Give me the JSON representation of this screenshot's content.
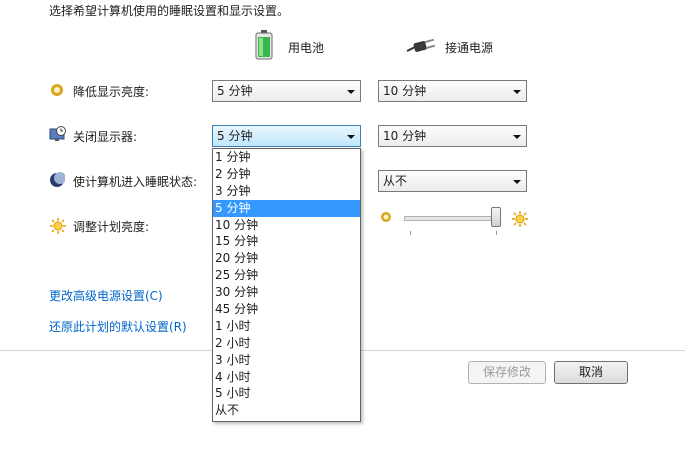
{
  "intro": "选择希望计算机使用的睡眠设置和显示设置。",
  "columns": {
    "battery": "用电池",
    "plugged": "接通电源"
  },
  "rows": {
    "dim": {
      "label": "降低显示亮度:",
      "battery_value": "5 分钟",
      "plugged_value": "10 分钟"
    },
    "display_off": {
      "label": "关闭显示器:",
      "battery_value": "5 分钟",
      "plugged_value": "10 分钟"
    },
    "sleep": {
      "label": "使计算机进入睡眠状态:",
      "plugged_value": "从不"
    },
    "brightness": {
      "label": "调整计划亮度:",
      "level_fraction": 1.0
    }
  },
  "dropdown": {
    "options": [
      "1 分钟",
      "2 分钟",
      "3 分钟",
      "5 分钟",
      "10 分钟",
      "15 分钟",
      "20 分钟",
      "25 分钟",
      "30 分钟",
      "45 分钟",
      "1 小时",
      "2 小时",
      "3 小时",
      "4 小时",
      "5 小时",
      "从不"
    ],
    "selected": "5 分钟"
  },
  "links": {
    "advanced": "更改高级电源设置(C)",
    "restore": "还原此计划的默认设置(R)"
  },
  "buttons": {
    "save": "保存修改",
    "cancel": "取消"
  },
  "icons": {
    "battery": "battery-icon",
    "plug": "power-plug-icon",
    "dim": "dim-brightness-icon",
    "display": "monitor-clock-icon",
    "sleep": "moon-sleep-icon",
    "brightness": "sun-icon"
  },
  "colors": {
    "link": "#0066cc",
    "highlight": "#3399ff",
    "focus_border": "#3c7fb1"
  }
}
